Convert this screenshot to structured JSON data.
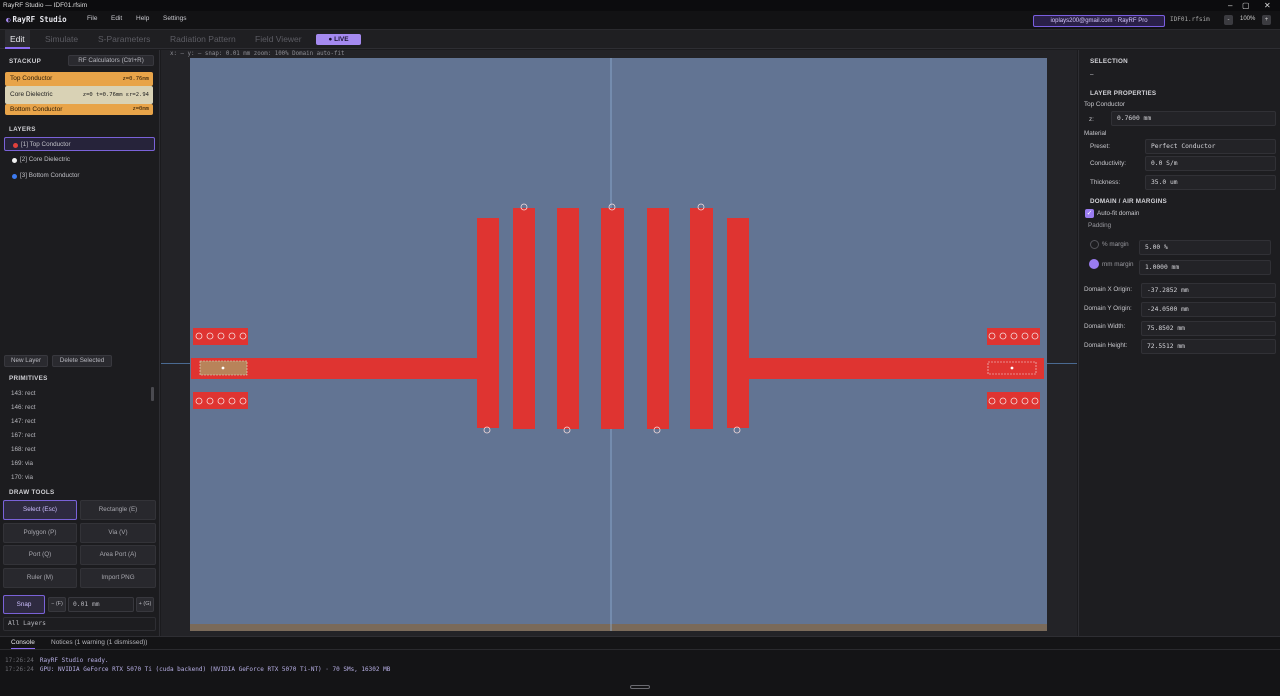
{
  "window": {
    "title": "RayRF Studio — IDF01.rfsim",
    "controls": [
      "–",
      "▢",
      "✕"
    ]
  },
  "menubar": {
    "app_name": "RayRF Studio",
    "menus": [
      "File",
      "Edit",
      "Help",
      "Settings"
    ],
    "account": "ioplays200@gmail.com · RayRF Pro",
    "filename": "IDF01.rfsim",
    "zoom": "100%"
  },
  "tabs": [
    {
      "label": "Edit"
    },
    {
      "label": "Simulate"
    },
    {
      "label": "S-Parameters"
    },
    {
      "label": "Radiation Pattern"
    },
    {
      "label": "Field Viewer"
    }
  ],
  "live_badge": "● LIVE",
  "left": {
    "stackup_title": "STACKUP",
    "rf_calc": "RF Calculators (Ctrl+R)",
    "stackup": [
      {
        "name": "Top Conductor",
        "info": "z=0.76mm",
        "color": "#e8a449"
      },
      {
        "name": "Core Dielectric",
        "info": "z=0   t=0.76mm   εr=2.94",
        "color": "#d9d2b5"
      },
      {
        "name": "Bottom Conductor",
        "info": "z=0mm",
        "color": "#e8a449"
      }
    ],
    "layers_title": "LAYERS",
    "layers": [
      {
        "label": "[1] Top Conductor",
        "color": "#e0403c"
      },
      {
        "label": "[2] Core Dielectric",
        "color": "#f0f0f0"
      },
      {
        "label": "[3] Bottom Conductor",
        "color": "#3d7bf0"
      }
    ],
    "new_layer": "New Layer",
    "delete_selected": "Delete Selected",
    "primitives_title": "PRIMITIVES",
    "primitives": [
      "143: rect",
      "146: rect",
      "147: rect",
      "167: rect",
      "168: rect",
      "169: via",
      "170: via"
    ],
    "draw_tools_title": "DRAW TOOLS",
    "tools": [
      "Select (Esc)",
      "Rectangle (E)",
      "Polygon (P)",
      "Via (V)",
      "Port (Q)",
      "Area Port (A)",
      "Ruler (M)",
      "Import PNG"
    ],
    "snap": {
      "label": "Snap",
      "minus": "− (F)",
      "value": "0.01 mm",
      "plus": "+ (G)"
    },
    "layer_filter": "All Layers"
  },
  "canvas": {
    "coords": "x: —   y: —    snap: 0.01 mm    zoom: 100%    Domain auto-fit"
  },
  "right": {
    "selection_title": "SELECTION",
    "selection_value": "–",
    "layer_props_title": "LAYER PROPERTIES",
    "layer_name": "Top Conductor",
    "z_label": "z:",
    "z_value": "0.7600 mm",
    "material_title": "Material",
    "preset_label": "Preset:",
    "preset_value": "Perfect Conductor",
    "conductivity_label": "Conductivity:",
    "conductivity_value": "0.0 S/m",
    "thickness_label": "Thickness:",
    "thickness_value": "35.0 um",
    "domain_title": "DOMAIN / AIR MARGINS",
    "autofit": "Auto-fit domain",
    "padding": "Padding",
    "pct_margin_label": "% margin",
    "pct_margin_value": "5.00 %",
    "mm_margin_label": "mm margin",
    "mm_margin_value": "1.0000 mm",
    "fields": [
      {
        "label": "Domain X Origin:",
        "value": "-37.2852 mm"
      },
      {
        "label": "Domain Y Origin:",
        "value": "-24.0500 mm"
      },
      {
        "label": "Domain Width:",
        "value": "75.8502 mm"
      },
      {
        "label": "Domain Height:",
        "value": "72.5512 mm"
      }
    ]
  },
  "console": {
    "tabs": [
      "Console",
      "Notices (1 warning (1 dismissed))"
    ],
    "lines": [
      {
        "time": "17:26:24",
        "text": "RayRF Studio ready."
      },
      {
        "time": "17:26:24",
        "text": "GPU: NVIDIA GeForce RTX 5070 Ti (cuda backend) (NVIDIA GeForce RTX 5070 Ti-NT) · 70 SMs, 16302 MB"
      }
    ]
  }
}
